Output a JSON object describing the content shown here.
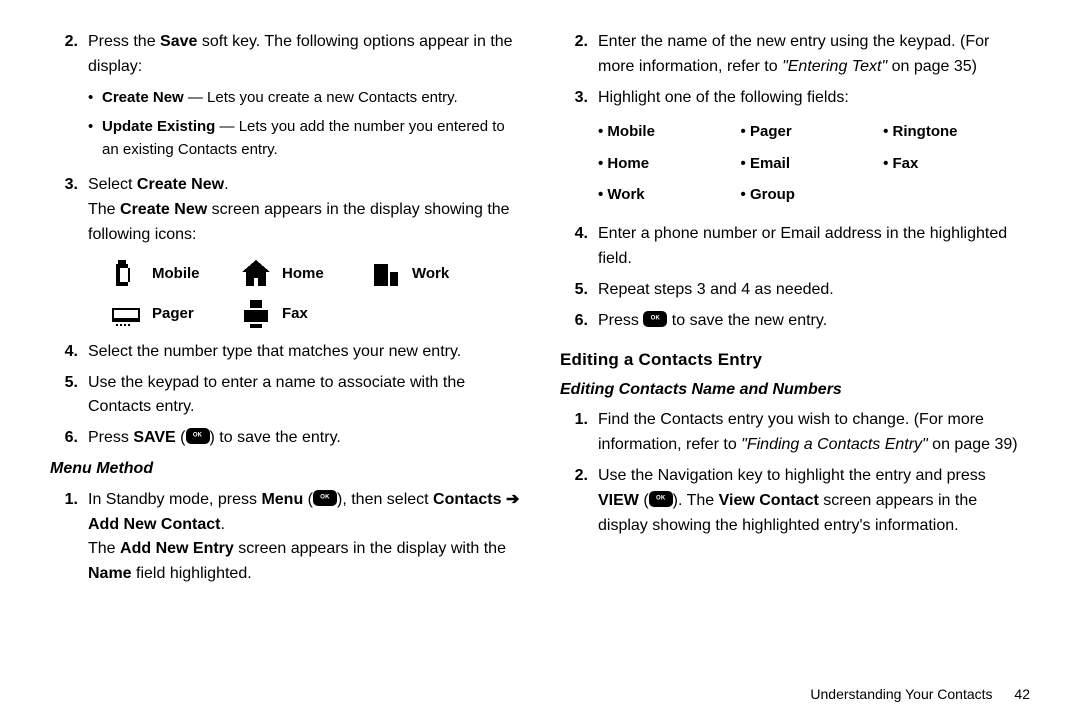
{
  "left": {
    "s2_a": "Press the ",
    "s2_b": "Save",
    "s2_c": " soft key. The following options appear in the display:",
    "bul1_a": "Create New",
    "bul1_b": " — Lets you create a new Contacts entry.",
    "bul2_a": "Update Existing",
    "bul2_b": " — Lets you add the number you entered to an existing Contacts entry.",
    "s3_a": "Select ",
    "s3_b": "Create New",
    "s3_c": ".",
    "s3_p_a": "The ",
    "s3_p_b": "Create New",
    "s3_p_c": " screen appears in the display showing the following icons:",
    "icons": {
      "mobile": "Mobile",
      "home": "Home",
      "work": "Work",
      "pager": "Pager",
      "fax": "Fax"
    },
    "s4": "Select the number type that matches your new entry.",
    "s5": "Use the keypad to enter a name to associate with the Contacts entry.",
    "s6_a": "Press ",
    "s6_b": "SAVE",
    "s6_c": " (",
    "s6_d": ") to save the entry.",
    "menu_heading": "Menu Method",
    "m1_a": "In Standby mode, press ",
    "m1_b": "Menu",
    "m1_c": " (",
    "m1_d": "), then select ",
    "m1_e": "Contacts ",
    "m1_arrow": "➔",
    "m1_f": " Add New Contact",
    "m1_g": ".",
    "m1_p_a": "The ",
    "m1_p_b": "Add New Entry",
    "m1_p_c": " screen appears in the display with the ",
    "m1_p_d": "Name",
    "m1_p_e": " field highlighted."
  },
  "right": {
    "s2_a": "Enter the name of the new entry using the keypad. (For more information, refer to ",
    "s2_b": "\"Entering Text\"",
    "s2_c": "  on page 35)",
    "s3": "Highlight one of the following fields:",
    "fields": [
      "Mobile",
      "Pager",
      "Ringtone",
      "Home",
      "Email",
      "Fax",
      "Work",
      "Group"
    ],
    "s4": "Enter a phone number or Email address in the highlighted field.",
    "s5": "Repeat steps 3 and 4 as needed.",
    "s6_a": "Press ",
    "s6_b": " to save the new entry.",
    "edit_heading": "Editing a Contacts Entry",
    "edit_sub": "Editing Contacts Name and Numbers",
    "e1_a": "Find the Contacts entry you wish to change. (For more information, refer to ",
    "e1_b": "\"Finding a Contacts Entry\"",
    "e1_c": "  on page 39)",
    "e2_a": "Use the Navigation key to highlight the entry and press ",
    "e2_b": "VIEW",
    "e2_c": " (",
    "e2_d": "). The ",
    "e2_e": "View Contact",
    "e2_f": " screen appears in the display showing the highlighted entry's information."
  },
  "footer": {
    "section": "Understanding Your Contacts",
    "page": "42"
  }
}
